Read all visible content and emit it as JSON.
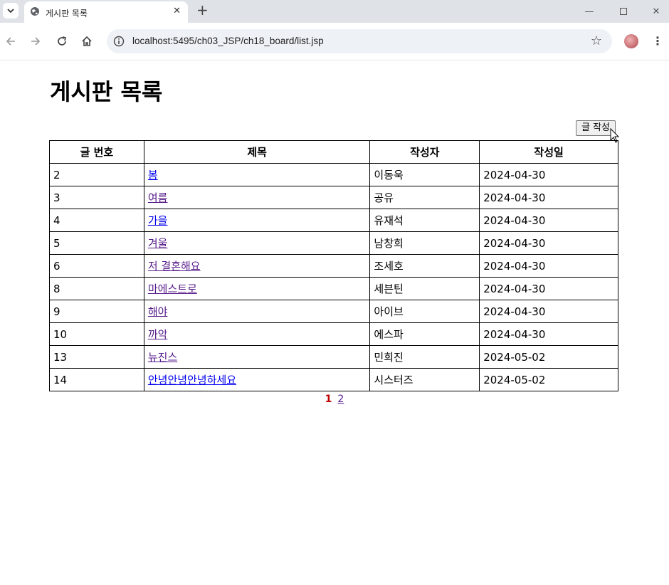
{
  "browser": {
    "tab_title": "게시판 목록",
    "url": "localhost:5495/ch03_JSP/ch18_board/list.jsp"
  },
  "page": {
    "title": "게시판 목록",
    "write_button": "글 작성"
  },
  "table": {
    "headers": [
      "글 번호",
      "제목",
      "작성자",
      "작성일"
    ],
    "rows": [
      {
        "no": "2",
        "title": "봄",
        "author": "이동욱",
        "date": "2024-04-30"
      },
      {
        "no": "3",
        "title": "여름",
        "author": "공유",
        "date": "2024-04-30"
      },
      {
        "no": "4",
        "title": "가을",
        "author": "유재석",
        "date": "2024-04-30"
      },
      {
        "no": "5",
        "title": "겨울",
        "author": "남창희",
        "date": "2024-04-30"
      },
      {
        "no": "6",
        "title": "저 결혼해요",
        "author": "조세호",
        "date": "2024-04-30"
      },
      {
        "no": "8",
        "title": "마에스트로",
        "author": "세븐틴",
        "date": "2024-04-30"
      },
      {
        "no": "9",
        "title": "해야",
        "author": "아이브",
        "date": "2024-04-30"
      },
      {
        "no": "10",
        "title": "까악",
        "author": "에스파",
        "date": "2024-04-30"
      },
      {
        "no": "13",
        "title": "뉴진스",
        "author": "민희진",
        "date": "2024-05-02"
      },
      {
        "no": "14",
        "title": "안녕안녕안녕하세요",
        "author": "시스터즈",
        "date": "2024-05-02"
      }
    ]
  },
  "pagination": {
    "current": "1",
    "pages": [
      "2"
    ]
  },
  "icons": {
    "tab_search": "chevron-down-icon",
    "favicon": "globe-icon",
    "tab_close": "close-icon",
    "new_tab": "plus-icon",
    "back": "back-arrow-icon",
    "forward": "forward-arrow-icon",
    "reload": "reload-icon",
    "home": "home-icon",
    "site_info": "info-icon",
    "bookmark": "star-icon",
    "menu": "kebab-menu-icon"
  },
  "colors": {
    "link": "#0000ee",
    "visited_link": "#551a8b",
    "current_page": "#c00000"
  }
}
